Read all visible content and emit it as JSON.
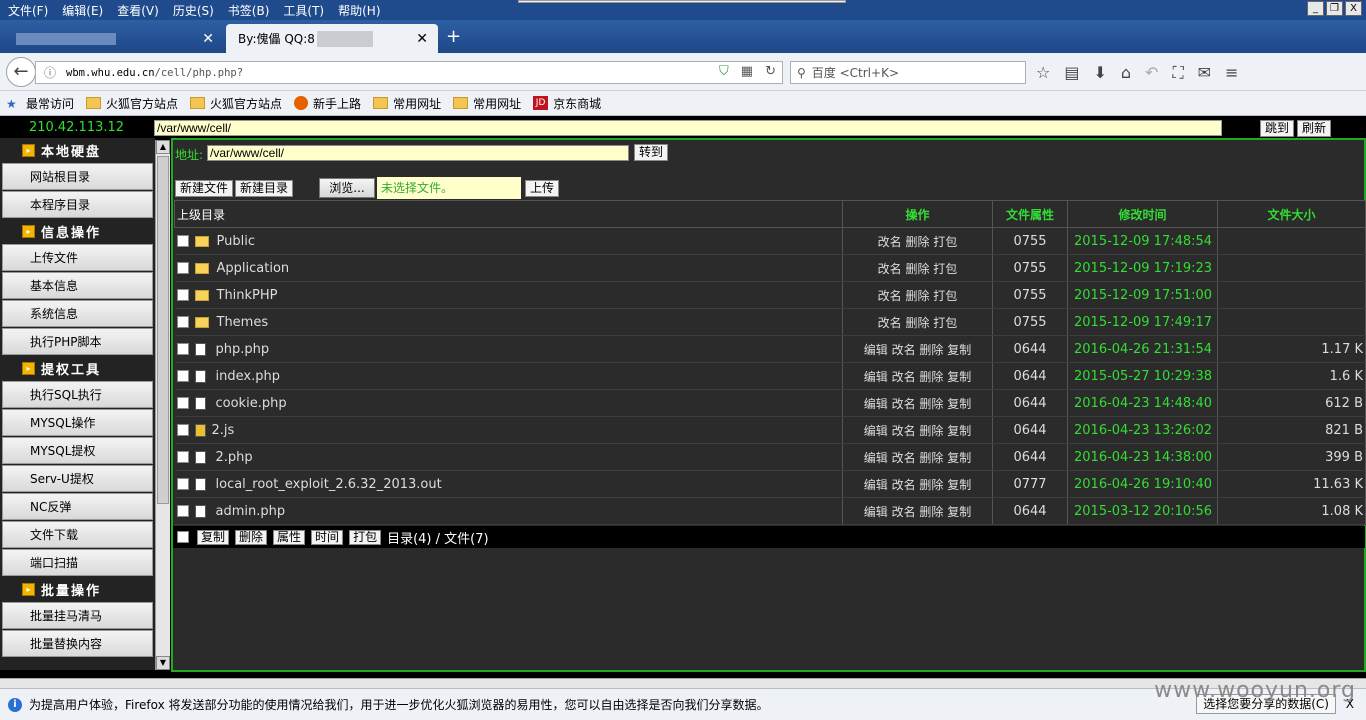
{
  "browser": {
    "menu": [
      "文件(F)",
      "编辑(E)",
      "查看(V)",
      "历史(S)",
      "书签(B)",
      "工具(T)",
      "帮助(H)"
    ],
    "window_buttons": [
      "_",
      "❐",
      "X"
    ],
    "tabs": [
      {
        "title": ""
      },
      {
        "title": "By:傀儡 QQ:8"
      }
    ],
    "new_tab": "+",
    "url_host": "wbm.whu.edu.cn",
    "url_path": "/cell/php.php?",
    "search_placeholder": "百度 <Ctrl+K>",
    "bookmarks": [
      {
        "label": "最常访问",
        "icon": "star-icon"
      },
      {
        "label": "火狐官方站点",
        "icon": "folder-icon"
      },
      {
        "label": "火狐官方站点",
        "icon": "folder-icon"
      },
      {
        "label": "新手上路",
        "icon": "firefox-icon"
      },
      {
        "label": "常用网址",
        "icon": "folder-icon"
      },
      {
        "label": "常用网址",
        "icon": "folder-icon"
      },
      {
        "label": "京东商城",
        "icon": "jd-icon"
      }
    ]
  },
  "page": {
    "ip": "210.42.113.12",
    "path_value": "/var/www/cell/",
    "jump_button": "跳到",
    "refresh_button": "刷新",
    "sidebar": [
      {
        "type": "head",
        "label": "本地硬盘"
      },
      {
        "type": "item",
        "label": "网站根目录"
      },
      {
        "type": "item",
        "label": "本程序目录"
      },
      {
        "type": "head",
        "label": "信息操作"
      },
      {
        "type": "item",
        "label": "上传文件"
      },
      {
        "type": "item",
        "label": "基本信息"
      },
      {
        "type": "item",
        "label": "系统信息"
      },
      {
        "type": "item",
        "label": "执行PHP脚本"
      },
      {
        "type": "head",
        "label": "提权工具"
      },
      {
        "type": "item",
        "label": "执行SQL执行"
      },
      {
        "type": "item",
        "label": "MYSQL操作"
      },
      {
        "type": "item",
        "label": "MYSQL提权"
      },
      {
        "type": "item",
        "label": "Serv-U提权"
      },
      {
        "type": "item",
        "label": "NC反弹"
      },
      {
        "type": "item",
        "label": "文件下载"
      },
      {
        "type": "item",
        "label": "端口扫描"
      },
      {
        "type": "head",
        "label": "批量操作"
      },
      {
        "type": "item",
        "label": "批量挂马清马"
      },
      {
        "type": "item",
        "label": "批量替换内容"
      }
    ],
    "address_label": "地址:",
    "address_value": "/var/www/cell/",
    "go_button": "转到",
    "new_file_button": "新建文件",
    "new_dir_button": "新建目录",
    "browse_button": "浏览...",
    "no_file_text": "未选择文件。",
    "upload_button": "上传",
    "table": {
      "headers": [
        "上级目录",
        "操作",
        "文件属性",
        "修改时间",
        "文件大小"
      ],
      "rows": [
        {
          "name": "Public",
          "type": "folder",
          "ops": "改名 删除 打包",
          "perm": "0755",
          "time": "2015-12-09 17:48:54",
          "size": ""
        },
        {
          "name": "Application",
          "type": "folder",
          "ops": "改名 删除 打包",
          "perm": "0755",
          "time": "2015-12-09 17:19:23",
          "size": ""
        },
        {
          "name": "ThinkPHP",
          "type": "folder",
          "ops": "改名 删除 打包",
          "perm": "0755",
          "time": "2015-12-09 17:51:00",
          "size": ""
        },
        {
          "name": "Themes",
          "type": "folder",
          "ops": "改名 删除 打包",
          "perm": "0755",
          "time": "2015-12-09 17:49:17",
          "size": ""
        },
        {
          "name": "php.php",
          "type": "file",
          "ops": "编辑 改名 删除 复制",
          "perm": "0644",
          "time": "2016-04-26 21:31:54",
          "size": "1.17 K"
        },
        {
          "name": "index.php",
          "type": "file",
          "ops": "编辑 改名 删除 复制",
          "perm": "0644",
          "time": "2015-05-27 10:29:38",
          "size": "1.6 K"
        },
        {
          "name": "cookie.php",
          "type": "file",
          "ops": "编辑 改名 删除 复制",
          "perm": "0644",
          "time": "2016-04-23 14:48:40",
          "size": "612 B"
        },
        {
          "name": "2.js",
          "type": "js",
          "ops": "编辑 改名 删除 复制",
          "perm": "0644",
          "time": "2016-04-23 13:26:02",
          "size": "821 B"
        },
        {
          "name": "2.php",
          "type": "file",
          "ops": "编辑 改名 删除 复制",
          "perm": "0644",
          "time": "2016-04-23 14:38:00",
          "size": "399 B"
        },
        {
          "name": "local_root_exploit_2.6.32_2013.out",
          "type": "file",
          "ops": "编辑 改名 删除 复制",
          "perm": "0777",
          "time": "2016-04-26 19:10:40",
          "size": "11.63 K"
        },
        {
          "name": "admin.php",
          "type": "file",
          "ops": "编辑 改名 删除 复制",
          "perm": "0644",
          "time": "2015-03-12 20:10:56",
          "size": "1.08 K"
        }
      ]
    },
    "footer": {
      "buttons": [
        "复制",
        "删除",
        "属性",
        "时间",
        "打包"
      ],
      "stats": "目录(4) / 文件(7)"
    }
  },
  "notification": {
    "message": "为提高用户体验，Firefox 将发送部分功能的使用情况给我们，用于进一步优化火狐浏览器的易用性，您可以自由选择是否向我们分享数据。",
    "share_button": "选择您要分享的数据(C)",
    "close": "X"
  },
  "watermark": "www.wooyun.org"
}
